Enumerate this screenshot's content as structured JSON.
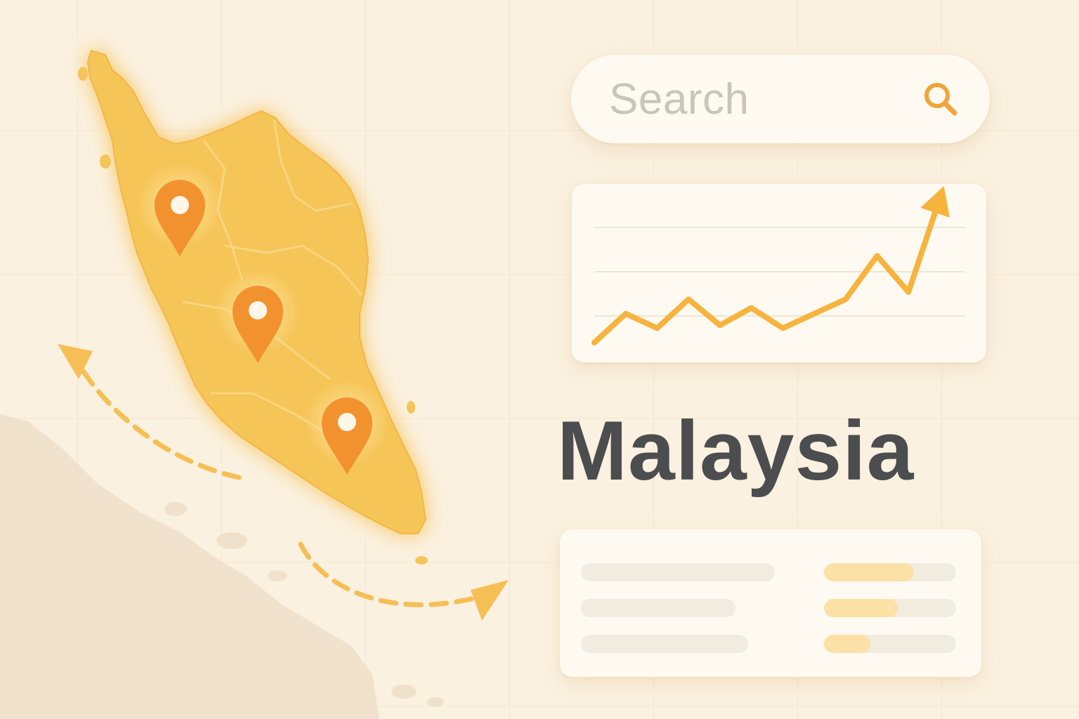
{
  "title": "Malaysia",
  "search": {
    "placeholder": "Search",
    "icon": "search-icon"
  },
  "colors": {
    "background": "#fbf1e0",
    "map_fill": "#f6c559",
    "pin": "#f2922f",
    "accent_line": "#f6b43e",
    "title_text": "#4b4d4f",
    "bar_fill": "#fbe1a6"
  },
  "map": {
    "pins": [
      {
        "name": "pin-north"
      },
      {
        "name": "pin-central"
      },
      {
        "name": "pin-south"
      }
    ]
  },
  "chart_data": {
    "type": "line",
    "values": [
      0,
      20,
      10,
      30,
      12,
      24,
      10,
      20,
      30,
      60,
      35,
      100
    ],
    "trend": "up",
    "grid": true
  },
  "list": {
    "rows": [
      {
        "progress": 0.68
      },
      {
        "progress": 0.56
      },
      {
        "progress": 0.35
      }
    ]
  }
}
